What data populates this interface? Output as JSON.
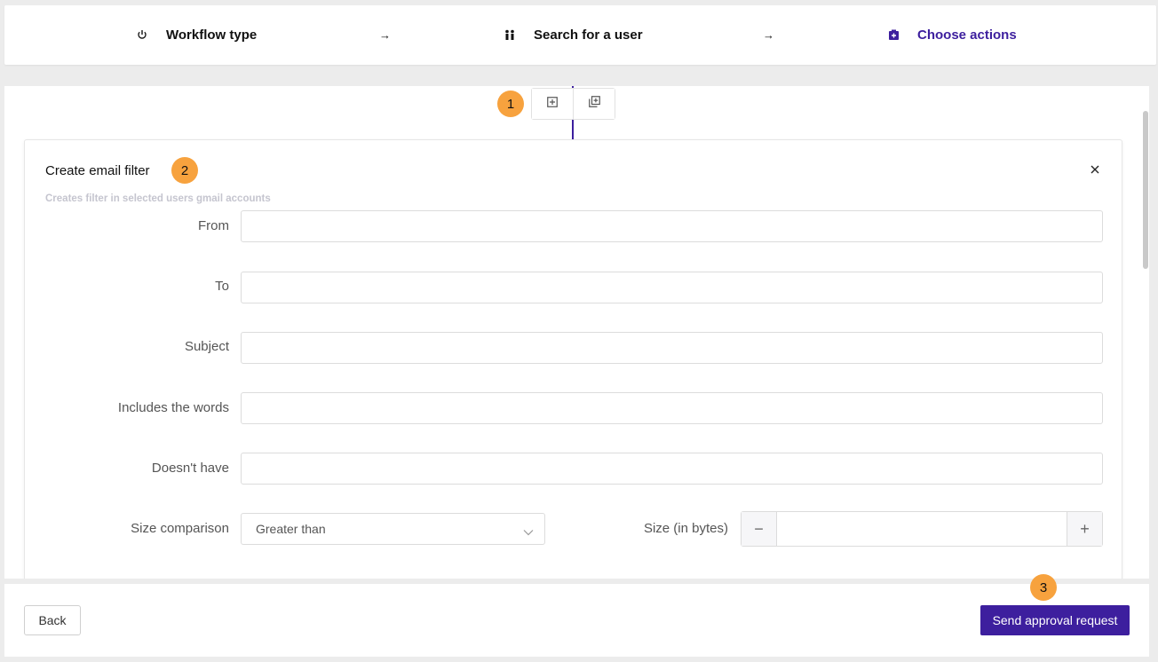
{
  "stepper": {
    "steps": [
      {
        "label": "Workflow type",
        "icon": "power-icon"
      },
      {
        "label": "Search for a user",
        "icon": "users-icon"
      },
      {
        "label": "Choose actions",
        "icon": "actions-icon"
      }
    ],
    "arrow": "→",
    "active_color": "#3d1f9e"
  },
  "badges": [
    "1",
    "2",
    "3"
  ],
  "card": {
    "title": "Create email filter",
    "subtitle": "Creates filter in selected users gmail accounts",
    "close": "×",
    "fields": [
      {
        "label": "From",
        "value": ""
      },
      {
        "label": "To",
        "value": ""
      },
      {
        "label": "Subject",
        "value": ""
      },
      {
        "label": "Includes the words",
        "value": ""
      },
      {
        "label": "Doesn't have",
        "value": ""
      }
    ],
    "size_comparison": {
      "label": "Size comparison",
      "value": "Greater than"
    },
    "size_bytes": {
      "label": "Size (in bytes)",
      "value": "",
      "minus": "−",
      "plus": "+"
    }
  },
  "footer": {
    "back_label": "Back",
    "send_label": "Send approval request"
  },
  "colors": {
    "accent": "#3d1f9e",
    "badge": "#f7a23e"
  }
}
